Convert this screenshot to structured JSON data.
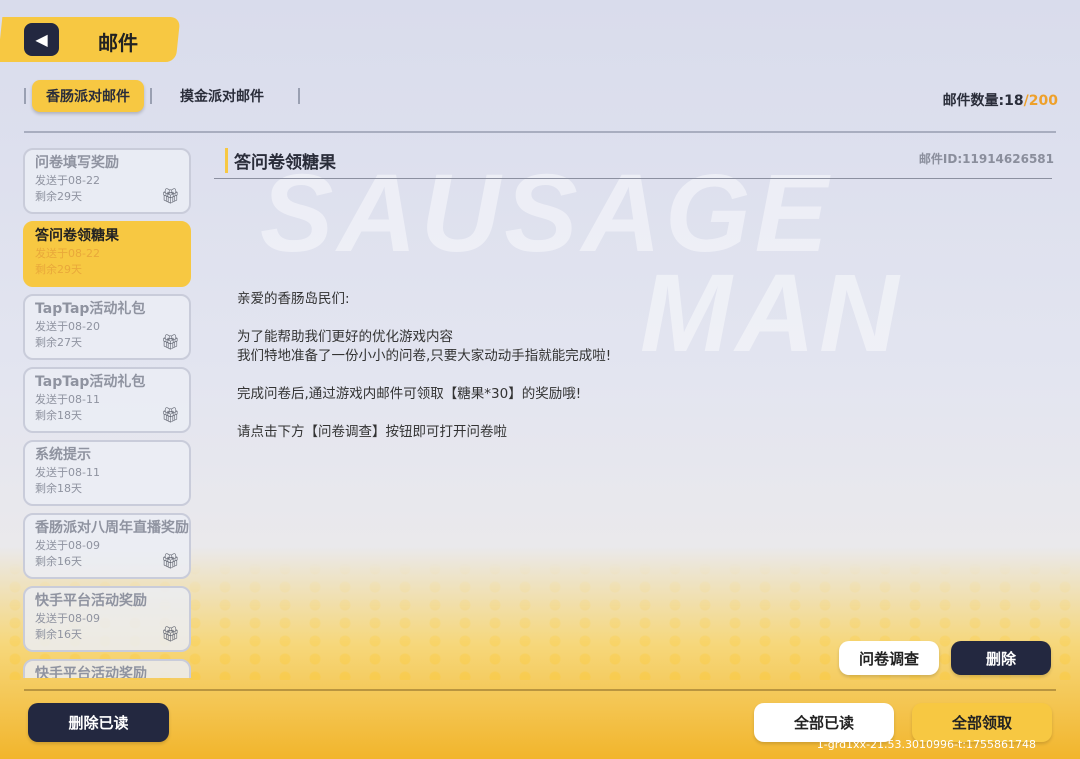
{
  "header": {
    "title": "邮件",
    "back_icon": "back-arrow-icon"
  },
  "tabs": [
    {
      "label": "香肠派对邮件",
      "active": true
    },
    {
      "label": "摸金派对邮件",
      "active": false
    }
  ],
  "mail_count": {
    "label": "邮件数量:",
    "current": "18",
    "max": "/200"
  },
  "mails": [
    {
      "title": "问卷填写奖励",
      "sent": "发送于08-22",
      "remain": "剩余29天",
      "gift": true
    },
    {
      "title": "答问卷领糖果",
      "sent": "发送于08-22",
      "remain": "剩余29天",
      "gift": false,
      "selected": true
    },
    {
      "title": "TapTap活动礼包",
      "sent": "发送于08-20",
      "remain": "剩余27天",
      "gift": true
    },
    {
      "title": "TapTap活动礼包",
      "sent": "发送于08-11",
      "remain": "剩余18天",
      "gift": true
    },
    {
      "title": "系统提示",
      "sent": "发送于08-11",
      "remain": "剩余18天",
      "gift": false
    },
    {
      "title": "香肠派对八周年直播奖励",
      "sent": "发送于08-09",
      "remain": "剩余16天",
      "gift": true
    },
    {
      "title": "快手平台活动奖励",
      "sent": "发送于08-09",
      "remain": "剩余16天",
      "gift": true
    },
    {
      "title": "快手平台活动奖励",
      "sent": "",
      "remain": "",
      "gift": false
    }
  ],
  "detail": {
    "subject": "答问卷领糖果",
    "mail_id": "邮件ID:11914626581",
    "body": [
      "亲爱的香肠岛民们:",
      "为了能帮助我们更好的优化游戏内容\n我们特地准备了一份小小的问卷,只要大家动动手指就能完成啦!",
      "完成问卷后,通过游戏内邮件可领取【糖果*30】的奖励哦!",
      "请点击下方【问卷调查】按钮即可打开问卷啦"
    ]
  },
  "buttons": {
    "survey": "问卷调查",
    "delete": "删除",
    "delete_read": "删除已读",
    "read_all": "全部已读",
    "claim_all": "全部领取"
  },
  "version": "1-grd1xx-21.53.3010996-t:1755861748",
  "colors": {
    "accent": "#f7c842",
    "dark": "#232840",
    "count_max": "#eea02b"
  }
}
